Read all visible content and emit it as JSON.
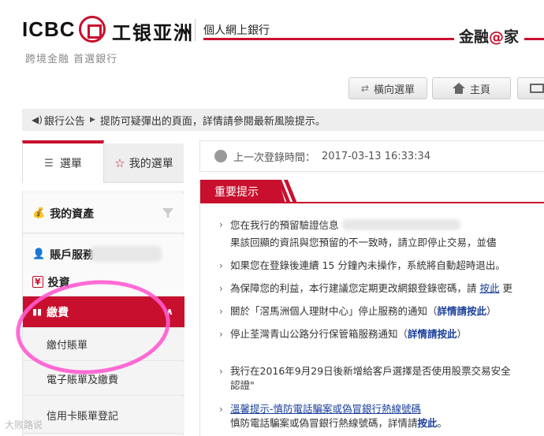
{
  "header": {
    "logo_en": "ICBC",
    "logo_cn": "工银亚洲",
    "slogan": "跨境金融 首選銀行",
    "site_name": "個人網上銀行",
    "brand_pre": "金融",
    "brand_at": "@",
    "brand_post": "家"
  },
  "topbar": {
    "horizontal_menu": "橫向選單",
    "home": "主頁"
  },
  "announcement": {
    "label": "銀行公告",
    "text": "提防可疑彈出的頁面，詳情請參閱最新風險提示。"
  },
  "sidebar": {
    "tab_menu": "選單",
    "tab_my_menu": "我的選單",
    "items": [
      {
        "label": "我的資產"
      },
      {
        "label": "賬戶服務"
      },
      {
        "label": "投資"
      },
      {
        "label": "繳費"
      }
    ],
    "sub_items": [
      {
        "label": "繳付賬單"
      },
      {
        "label": "電子賬單及繳費"
      },
      {
        "label": "信用卡賬單登記"
      }
    ]
  },
  "login": {
    "label": "上一次登錄時間：",
    "value": "2017-03-13 16:33:34"
  },
  "notices": {
    "tab": "重要提示",
    "items": [
      {
        "text": "您在我行的預留驗證信息"
      },
      {
        "text": "果該回顯的資訊與您預留的不一致時，請立即停止交易，並儘"
      },
      {
        "text": "如果您在登錄後連續 15 分鐘內未操作，系統將自動超時退出。"
      },
      {
        "text": "為保障您的利益，本行建議您定期更改網銀登錄密碼，請",
        "link": "按此",
        "tail": "更"
      },
      {
        "text": "關於「滘馬洲個人理財中心」停止服務的通知（",
        "link": "詳情請按此",
        "tail": "）"
      },
      {
        "text": "停止荃灣青山公路分行保管箱服務通知（",
        "link": "詳情請按此",
        "tail": "）"
      },
      {
        "text": "我行在2016年9月29日後新增給客戶選擇是否使用股票交易安全"
      },
      {
        "text": "認證\""
      },
      {
        "text": "溫馨提示-慎防電話騙案或偽冒銀行熱線號碼"
      },
      {
        "text": "慎防電話騙案或偽冒銀行熱線號碼，詳情請",
        "link": "按此",
        "tail": "。"
      }
    ]
  },
  "watermark": "大败路说"
}
